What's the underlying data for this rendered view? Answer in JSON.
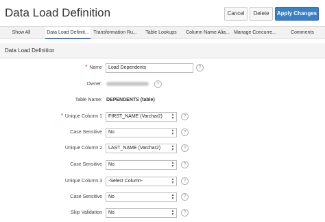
{
  "header": {
    "title": "Data Load Definition",
    "cancel_label": "Cancel",
    "delete_label": "Delete",
    "apply_label": "Apply Changes"
  },
  "tabs": [
    {
      "label": "Show All",
      "active": false
    },
    {
      "label": "Data Load Definiti...",
      "active": true
    },
    {
      "label": "Transformation Ru...",
      "active": false
    },
    {
      "label": "Table Lookups",
      "active": false
    },
    {
      "label": "Column Name Alia...",
      "active": false
    },
    {
      "label": "Manage Concurre...",
      "active": false
    },
    {
      "label": "Comments",
      "active": false
    }
  ],
  "region": {
    "title": "Data Load Definition"
  },
  "form": {
    "name": {
      "label": "Name",
      "value": "Load Dependents",
      "required": true
    },
    "owner": {
      "label": "Owner:"
    },
    "table_name": {
      "label": "Table Name:",
      "value": "DEPENDENTS (table)"
    },
    "unique_column_1": {
      "label": "Unique Column 1",
      "value": "FIRST_NAME (Varchar2)",
      "required": true
    },
    "case_sensitive_1": {
      "label": "Case Sensitive",
      "value": "No"
    },
    "unique_column_2": {
      "label": "Unique Column 2",
      "value": "LAST_NAME (Varchar2)"
    },
    "case_sensitive_2": {
      "label": "Case Sensitive",
      "value": "No"
    },
    "unique_column_3": {
      "label": "Unique Column 3",
      "value": "-Select Column-"
    },
    "case_sensitive_3": {
      "label": "Case Sensitive",
      "value": "No"
    },
    "skip_validation": {
      "label": "Skip Validation",
      "value": "No"
    }
  },
  "icons": {
    "help": "question-circle-icon",
    "select_arrows": "up-down-arrows-icon"
  },
  "colors": {
    "accent": "#3b7fc4",
    "required": "#dd3333"
  }
}
